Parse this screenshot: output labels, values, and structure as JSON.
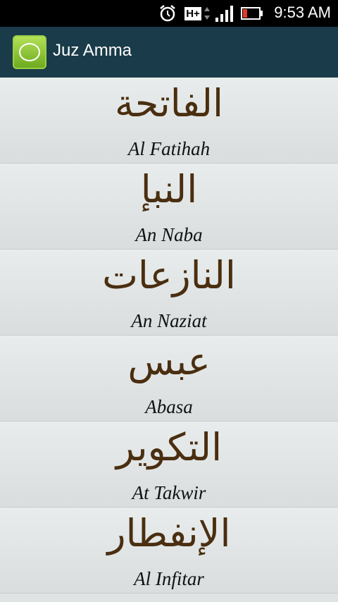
{
  "status_bar": {
    "time": "9:53 AM",
    "network_label": "H+",
    "icons": [
      "alarm-icon",
      "network-type-icon",
      "signal-icon",
      "battery-icon"
    ]
  },
  "action_bar": {
    "title": "Juz Amma",
    "icon": "app-logo-icon"
  },
  "surahs": [
    {
      "arabic": "الفاتحة",
      "latin": "Al Fatihah"
    },
    {
      "arabic": "النبإ",
      "latin": "An Naba"
    },
    {
      "arabic": "النازعات",
      "latin": "An Naziat"
    },
    {
      "arabic": "عبس",
      "latin": "Abasa"
    },
    {
      "arabic": "التكوير",
      "latin": "At Takwir"
    },
    {
      "arabic": "الإنفطار",
      "latin": "Al Infitar"
    }
  ],
  "colors": {
    "action_bar": "#1a3b49",
    "arabic_text": "#4a2e10",
    "list_background": "#dfe3e3"
  }
}
